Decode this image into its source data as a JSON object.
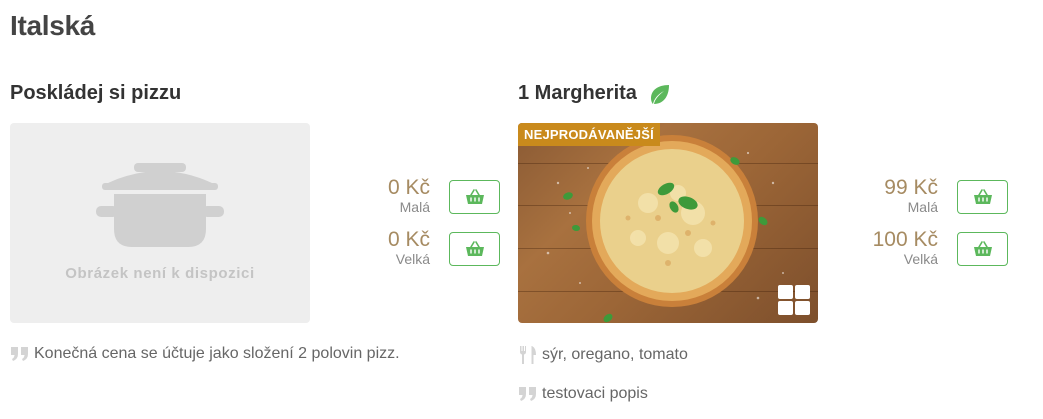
{
  "category": {
    "title": "Italská"
  },
  "products": [
    {
      "name": "Poskládej si pizzu",
      "image_placeholder_text": "Obrázek není k dispozici",
      "prices": [
        {
          "amount": "0 Kč",
          "size": "Malá"
        },
        {
          "amount": "0 Kč",
          "size": "Velká"
        }
      ],
      "note": "Konečná cena se účtuje jako složení 2 polovin pizz."
    },
    {
      "name": "1 Margherita",
      "badge": "NEJPRODÁVANĚJŠÍ",
      "prices": [
        {
          "amount": "99 Kč",
          "size": "Malá"
        },
        {
          "amount": "100 Kč",
          "size": "Velká"
        }
      ],
      "ingredients": "sýr, oregano, tomato",
      "description": "testovaci popis"
    }
  ],
  "icons": {
    "vegetarian": "leaf-icon",
    "cart": "basket-icon",
    "quote": "quote-icon",
    "ingredients": "fork-knife-icon",
    "gallery": "grid-icon",
    "placeholder": "pot-icon"
  },
  "colors": {
    "price": "#a68b62",
    "cart_border": "#5cb85c",
    "badge": "#c98a1c",
    "leaf": "#5cb85c",
    "placeholder_bg": "#eeeeee"
  }
}
